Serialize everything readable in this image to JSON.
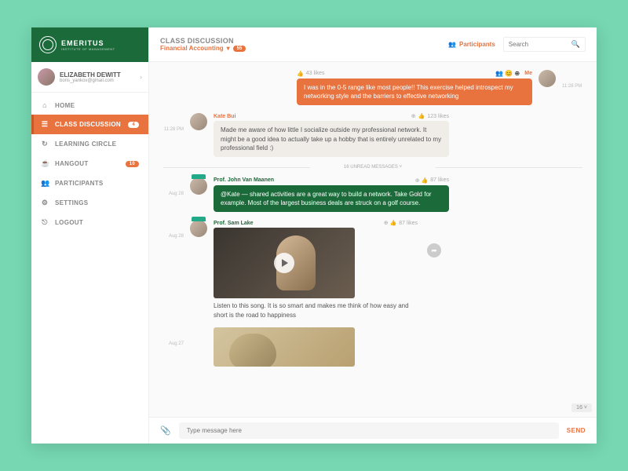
{
  "brand": {
    "name": "EMERITUS",
    "subtitle": "INSTITUTE OF MANAGEMENT"
  },
  "user": {
    "name": "ELIZABETH DEWITT",
    "email": "boris_yankov@gmail.com"
  },
  "nav": {
    "home": "HOME",
    "discussion": "CLASS DISCUSSION",
    "discussion_badge": "4",
    "learning": "LEARNING CIRCLE",
    "hangout": "HANGOUT",
    "hangout_badge": "10",
    "participants": "PARTICIPANTS",
    "settings": "SETTINGS",
    "logout": "LOGOUT"
  },
  "topbar": {
    "title": "CLASS DISCUSSION",
    "course": "Financial Accounting",
    "count": "55",
    "participants": "Participants",
    "search_placeholder": "Search"
  },
  "messages": {
    "m0": {
      "name": "Me",
      "likes": "43 likes",
      "time": "11:28 PM",
      "text": "I was in the 0-5 range like most people!! This exercise helped introspect my networking style and the barriers to effective networking"
    },
    "m1": {
      "name": "Kate Bui",
      "likes": "123 likes",
      "time": "11:28 PM",
      "text": "Made me aware of how little I socialize outside my professional network. It might be a good idea to actually take up a hobby that is entirely unrelated to my professional field :)"
    },
    "divider": "16 UNREAD MESSAGES",
    "m2": {
      "name": "Prof. John Van Maanen",
      "likes": "87 likes",
      "date": "Aug 28",
      "text": "@Kate — shared activities are a great way to build a network. Take Gold for example. Most of the largest business deals are struck on a golf course."
    },
    "m3": {
      "name": "Prof. Sam Lake",
      "likes": "87 likes",
      "date": "Aug 28",
      "text": "Listen to this song. It is so smart and makes me think of how easy and short is the road to happiness"
    },
    "m4": {
      "date": "Aug 27"
    }
  },
  "compose": {
    "placeholder": "Type message here",
    "send": "SEND"
  },
  "pager": "16 ˅"
}
